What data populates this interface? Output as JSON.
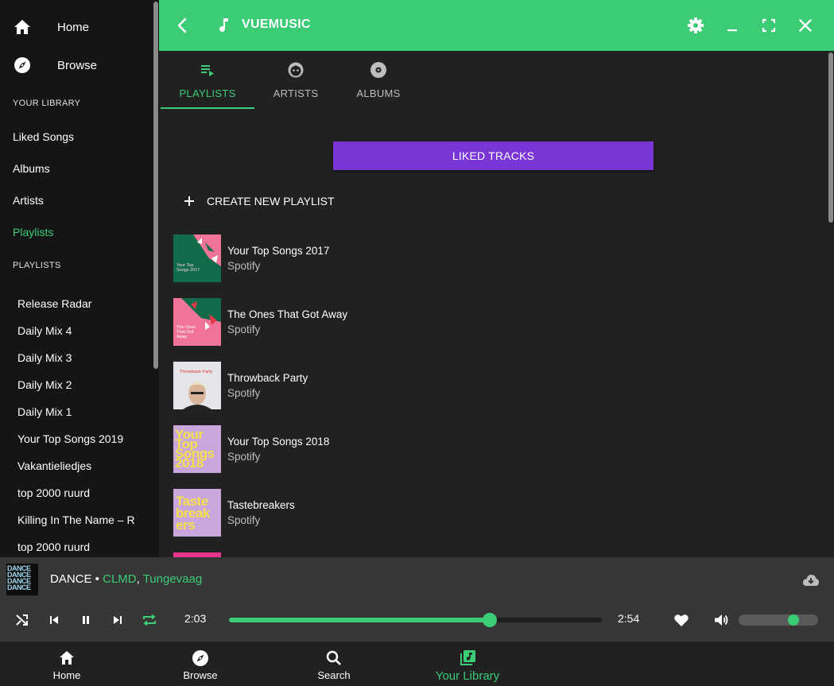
{
  "colors": {
    "accent": "#3bcc75",
    "purple": "#7a35d6",
    "sidebar": "#151515",
    "main": "#212121",
    "player": "#363636"
  },
  "header": {
    "title": "VUEMUSIC"
  },
  "sidebar": {
    "home_label": "Home",
    "browse_label": "Browse",
    "library_heading": "YOUR LIBRARY",
    "library_items": [
      {
        "label": "Liked Songs"
      },
      {
        "label": "Albums"
      },
      {
        "label": "Artists"
      },
      {
        "label": "Playlists"
      }
    ],
    "playlists_heading": "PLAYLISTS",
    "playlists": [
      {
        "label": "Release Radar"
      },
      {
        "label": "Daily Mix 4"
      },
      {
        "label": "Daily Mix 3"
      },
      {
        "label": "Daily Mix 2"
      },
      {
        "label": "Daily Mix 1"
      },
      {
        "label": "Your Top Songs 2019"
      },
      {
        "label": "Vakantieliedjes"
      },
      {
        "label": "top 2000 ruurd"
      },
      {
        "label": "Killing In The Name – R"
      },
      {
        "label": "top 2000 ruurd"
      }
    ]
  },
  "tabs": [
    {
      "label": "PLAYLISTS",
      "icon": "playlist-play-icon"
    },
    {
      "label": "ARTISTS",
      "icon": "face-icon"
    },
    {
      "label": "ALBUMS",
      "icon": "disc-icon"
    }
  ],
  "main": {
    "liked_button": "LIKED TRACKS",
    "create_label": "CREATE NEW PLAYLIST",
    "playlists": [
      {
        "name": "Your Top Songs 2017",
        "owner": "Spotify",
        "cover_text": "Your Top Songs 2017"
      },
      {
        "name": "The Ones That Got Away",
        "owner": "Spotify",
        "cover_text": "The Ones That Got Away"
      },
      {
        "name": "Throwback Party",
        "owner": "Spotify",
        "cover_text": "Throwback Party"
      },
      {
        "name": "Your Top Songs 2018",
        "owner": "Spotify",
        "cover_text": "Your Top Songs 2018"
      },
      {
        "name": "Tastebreakers",
        "owner": "Spotify",
        "cover_text": "Taste break ers"
      }
    ]
  },
  "player": {
    "track": "DANCE",
    "separator": " • ",
    "artist1": "CLMD",
    "artist_sep": ", ",
    "artist2": "Tungevaag",
    "current_time": "2:03",
    "duration": "2:54",
    "progress_fraction": 0.7,
    "volume_fraction": 0.62,
    "cover_text": "DANCE"
  },
  "bottom_nav": [
    {
      "label": "Home",
      "icon": "home-icon"
    },
    {
      "label": "Browse",
      "icon": "compass-icon"
    },
    {
      "label": "Search",
      "icon": "search-icon"
    },
    {
      "label": "Your Library",
      "icon": "library-music-icon"
    }
  ]
}
